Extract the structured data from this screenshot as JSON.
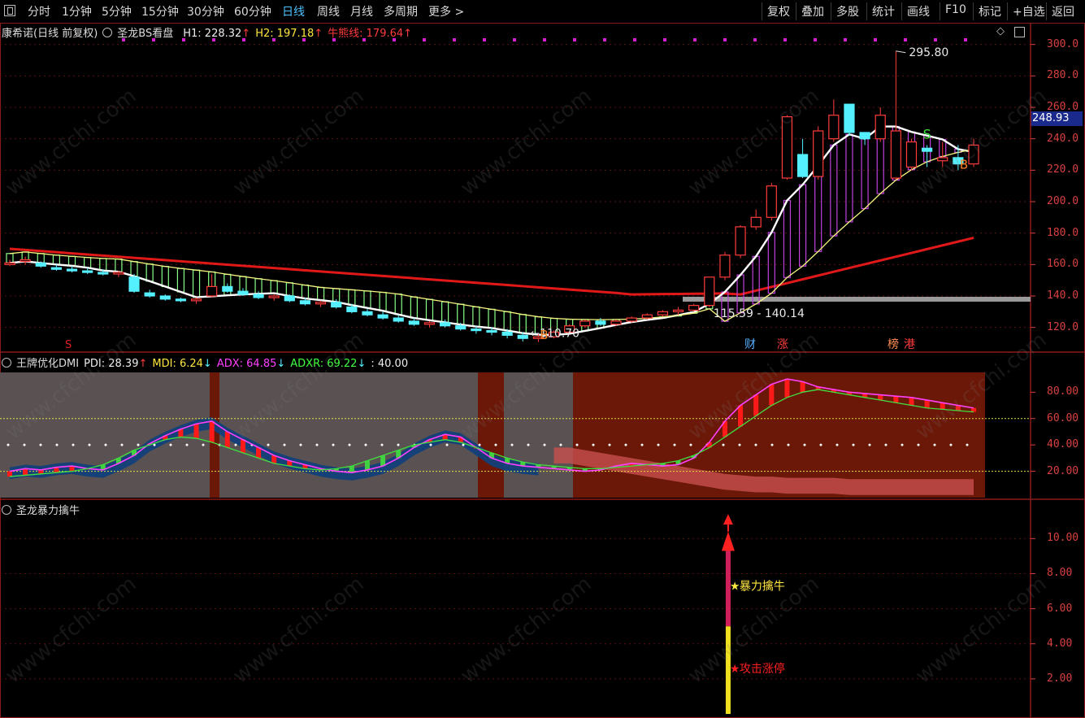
{
  "toolbar": {
    "left": [
      "分时",
      "1分钟",
      "5分钟",
      "15分钟",
      "30分钟",
      "60分钟",
      "日线",
      "周线",
      "月线",
      "多周期",
      "更多 >"
    ],
    "active": "日线",
    "right": [
      "复权",
      "叠加",
      "多股",
      "统计",
      "画线",
      "F10",
      "标记",
      "+自选",
      "返回"
    ]
  },
  "main_legend": {
    "stock": "康希诺(日线 前复权)",
    "indicator": "圣龙BS看盘",
    "h1": "H1: 228.32",
    "h2": "H2: 197.18",
    "bear": "牛熊线: 179.64"
  },
  "main_axis": [
    "300.0",
    "280.0",
    "260.0",
    "240.0",
    "220.0",
    "200.0",
    "180.0",
    "160.0",
    "140.0",
    "120.0"
  ],
  "price_tag": "248.93",
  "annotations": {
    "high": "295.80",
    "low": "110.70",
    "range": "115.59 - 140.14",
    "s_mark": "S",
    "b_mark": "B",
    "s_left": "S",
    "news": [
      "财",
      "涨",
      "榜",
      "港"
    ]
  },
  "dmi_legend": {
    "name": "王牌优化DMI",
    "pdi": "PDI: 28.39",
    "mdi": "MDI: 6.24",
    "adx": "ADX: 64.85",
    "adxr": "ADXR: 69.22",
    "level": ": 40.00"
  },
  "dmi_axis": [
    "80.00",
    "60.00",
    "40.00",
    "20.00"
  ],
  "bull_legend": {
    "name": "圣龙暴力擒牛"
  },
  "bull_axis": [
    "10.00",
    "8.00",
    "6.00",
    "4.00",
    "2.00"
  ],
  "bull_labels": {
    "top": "暴力擒牛",
    "bottom": "攻击涨停"
  },
  "watermark": "www.cfchi.com",
  "colors": {
    "up": "#ff3b3b",
    "down": "#54f0ff",
    "axis": "#d84040",
    "active": "#4ec3ff"
  },
  "chart_data": {
    "type": "candlestick",
    "price_ylim": [
      110,
      305
    ],
    "candles": [
      [
        160,
        163,
        159,
        161
      ],
      [
        162,
        165,
        160,
        163
      ],
      [
        161,
        162,
        158,
        159
      ],
      [
        158,
        160,
        156,
        157
      ],
      [
        157,
        159,
        155,
        156
      ],
      [
        156,
        158,
        154,
        155
      ],
      [
        155,
        157,
        153,
        154
      ],
      [
        154,
        156,
        152,
        155
      ],
      [
        152,
        154,
        142,
        143
      ],
      [
        142,
        144,
        139,
        140
      ],
      [
        140,
        141,
        137,
        138
      ],
      [
        138,
        139,
        136,
        137
      ],
      [
        137,
        139,
        135,
        138
      ],
      [
        140,
        154,
        139,
        146
      ],
      [
        146,
        148,
        142,
        143
      ],
      [
        143,
        145,
        140,
        141
      ],
      [
        141,
        143,
        138,
        139
      ],
      [
        139,
        141,
        137,
        140
      ],
      [
        140,
        141,
        136,
        137
      ],
      [
        137,
        139,
        134,
        135
      ],
      [
        135,
        137,
        133,
        136
      ],
      [
        136,
        138,
        132,
        133
      ],
      [
        133,
        135,
        129,
        130
      ],
      [
        130,
        132,
        127,
        128
      ],
      [
        128,
        130,
        125,
        126
      ],
      [
        126,
        128,
        123,
        124
      ],
      [
        124,
        126,
        121,
        122
      ],
      [
        122,
        124,
        120,
        123
      ],
      [
        123,
        125,
        120,
        121
      ],
      [
        121,
        123,
        118,
        119
      ],
      [
        119,
        121,
        116,
        118
      ],
      [
        118,
        120,
        115,
        117
      ],
      [
        117,
        119,
        113,
        115
      ],
      [
        115,
        117,
        111,
        113
      ],
      [
        113,
        116,
        110.7,
        114
      ],
      [
        114,
        118,
        113,
        117
      ],
      [
        117,
        122,
        116,
        121
      ],
      [
        121,
        125,
        120,
        124
      ],
      [
        124,
        126,
        121,
        122
      ],
      [
        122,
        125,
        121,
        124
      ],
      [
        124,
        127,
        123,
        126
      ],
      [
        126,
        129,
        125,
        128
      ],
      [
        128,
        131,
        127,
        130
      ],
      [
        130,
        133,
        128,
        131
      ],
      [
        131,
        135,
        130,
        134
      ],
      [
        134,
        152,
        133,
        152
      ],
      [
        152,
        168,
        150,
        166
      ],
      [
        166,
        185,
        164,
        184
      ],
      [
        184,
        195,
        182,
        190
      ],
      [
        190,
        212,
        188,
        210
      ],
      [
        215,
        255,
        214,
        254
      ],
      [
        230,
        240,
        215,
        216
      ],
      [
        216,
        248,
        214,
        245
      ],
      [
        240,
        265,
        238,
        255
      ],
      [
        262,
        258,
        242,
        244
      ],
      [
        244,
        240,
        236,
        240
      ],
      [
        240,
        260,
        238,
        255
      ],
      [
        215,
        295.8,
        214,
        245
      ],
      [
        222,
        240,
        220,
        238
      ],
      [
        234,
        236,
        222,
        232
      ],
      [
        226,
        238,
        222,
        228
      ],
      [
        228,
        236,
        220,
        224
      ],
      [
        224,
        240,
        222,
        236
      ]
    ],
    "dmi": {
      "pdi": [
        20,
        22,
        21,
        23,
        24,
        22,
        21,
        26,
        32,
        41,
        47,
        52,
        56,
        58,
        50,
        44,
        38,
        32,
        28,
        25,
        22,
        20,
        19,
        21,
        24,
        30,
        38,
        44,
        48,
        46,
        38,
        30,
        26,
        24,
        23,
        22,
        21,
        20,
        21,
        24,
        26,
        25,
        24,
        25,
        30,
        42,
        58,
        70,
        78,
        86,
        90,
        88,
        84,
        82,
        80,
        79,
        78,
        77,
        76,
        74,
        72,
        70,
        68
      ],
      "mdi": [
        14,
        15,
        16,
        17,
        18,
        17,
        16,
        15,
        14,
        13,
        15,
        16,
        17,
        18,
        19,
        20,
        22,
        25,
        30,
        34,
        38,
        42,
        46,
        48,
        50,
        52,
        55,
        57,
        58,
        56,
        52,
        48,
        44,
        40,
        36,
        34,
        30,
        28,
        26,
        24,
        22,
        20,
        18,
        16,
        14,
        12,
        10,
        9,
        8,
        8,
        7,
        7,
        7,
        7,
        6,
        6,
        6,
        6,
        6,
        6,
        6,
        6,
        6
      ],
      "adx": [
        16,
        17,
        18,
        19,
        20,
        22,
        25,
        30,
        36,
        40,
        44,
        46,
        45,
        42,
        38,
        34,
        30,
        26,
        24,
        22,
        21,
        22,
        24,
        28,
        32,
        36,
        40,
        42,
        44,
        42,
        38,
        34,
        30,
        27,
        25,
        24,
        23,
        22,
        22,
        23,
        24,
        25,
        26,
        28,
        32,
        38,
        46,
        54,
        62,
        70,
        76,
        80,
        82,
        80,
        78,
        76,
        74,
        72,
        70,
        68,
        67,
        66,
        65
      ],
      "ylim": [
        0,
        95
      ]
    },
    "bull": {
      "bar_index": 46,
      "yellow_top": 5.0,
      "red_top": 10.0,
      "ylim": [
        0,
        11.5
      ]
    }
  }
}
